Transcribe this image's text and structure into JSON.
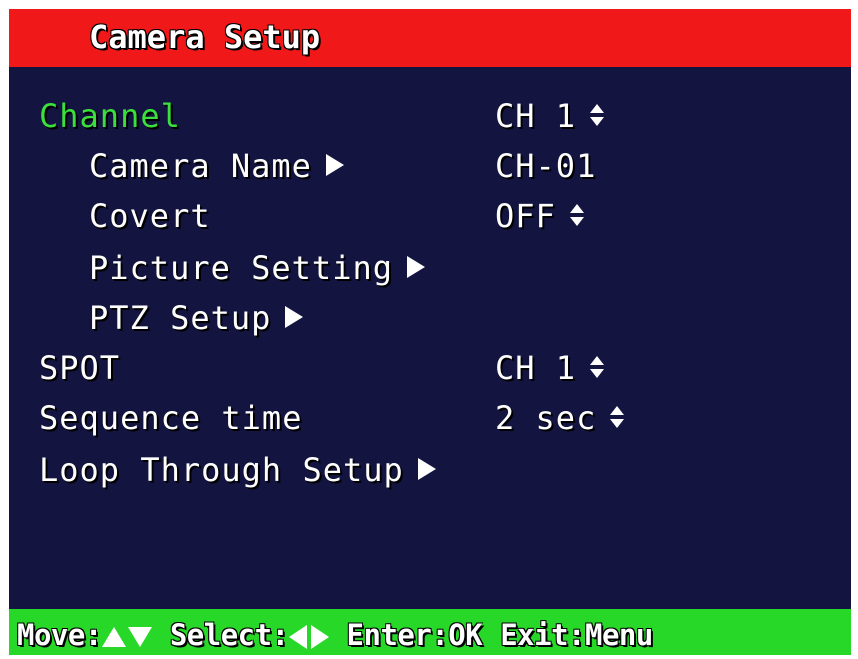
{
  "title": "Camera Setup",
  "colors": {
    "title_bar": "#f01818",
    "background": "#131540",
    "footer_bar": "#28d828",
    "selected_text": "#3ce03c",
    "text": "#ffffff"
  },
  "menu": {
    "channel": {
      "label": "Channel",
      "value": "CH 1",
      "icon": "up-down-icon",
      "selected": true
    },
    "camera_name": {
      "label": "Camera Name",
      "value": "CH-01",
      "icon": "right-arrow-icon"
    },
    "covert": {
      "label": "Covert",
      "value": "OFF",
      "icon": "up-down-icon"
    },
    "picture_setting": {
      "label": "Picture Setting",
      "icon": "right-arrow-icon"
    },
    "ptz_setup": {
      "label": "PTZ Setup",
      "icon": "right-arrow-icon"
    },
    "spot": {
      "label": "SPOT",
      "value": "CH 1",
      "icon": "up-down-icon"
    },
    "sequence_time": {
      "label": "Sequence time",
      "value": "2 sec",
      "icon": "up-down-icon"
    },
    "loop_through_setup": {
      "label": "Loop Through Setup",
      "icon": "right-arrow-icon"
    }
  },
  "footer": {
    "move_label": "Move:",
    "move_icons": "up-down-arrows-icon",
    "select_label": "Select:",
    "select_icons": "left-right-arrows-icon",
    "enter_label": "Enter:OK",
    "exit_label": "Exit:Menu"
  }
}
